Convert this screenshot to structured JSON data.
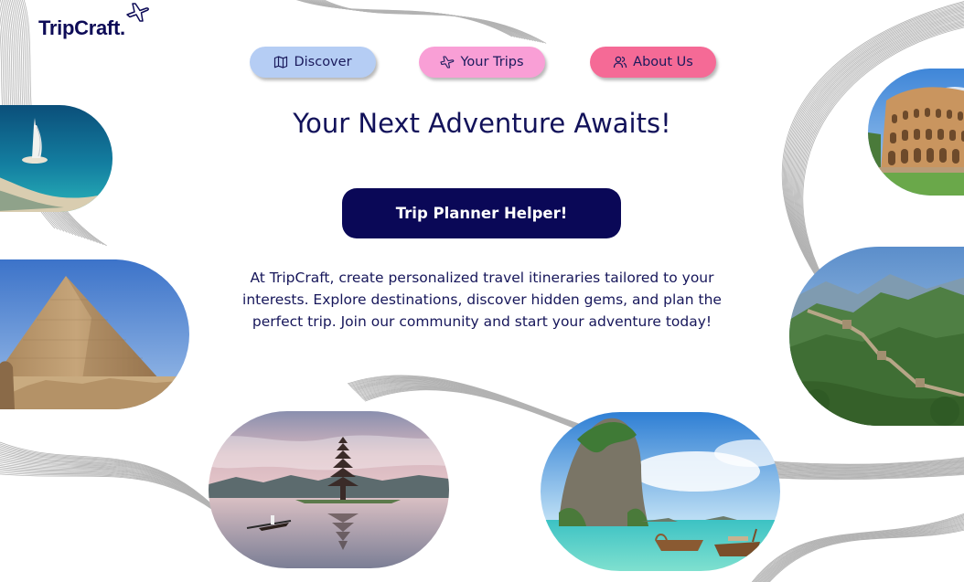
{
  "brand": {
    "name": "TripCraft.",
    "color": "#0d0b57"
  },
  "nav": {
    "items": [
      {
        "label": "Discover",
        "icon": "map-icon",
        "color": "#b5cdf4"
      },
      {
        "label": "Your Trips",
        "icon": "airplane-icon",
        "color": "#f99fd6"
      },
      {
        "label": "About Us",
        "icon": "users-icon",
        "color": "#f56a96"
      }
    ]
  },
  "hero": {
    "headline": "Your Next Adventure Awaits!",
    "cta_label": "Trip Planner Helper!",
    "cta_color": "#0a0857",
    "description": "At TripCraft, create personalized travel itineraries tailored to your interests. Explore destinations, discover hidden gems, and plan the perfect trip. Join our community and start your adventure today!"
  },
  "photos": [
    {
      "name": "dubai-photo"
    },
    {
      "name": "pyramid-photo"
    },
    {
      "name": "colosseum-photo"
    },
    {
      "name": "great-wall-photo"
    },
    {
      "name": "bali-temple-photo"
    },
    {
      "name": "thailand-beach-photo"
    }
  ]
}
